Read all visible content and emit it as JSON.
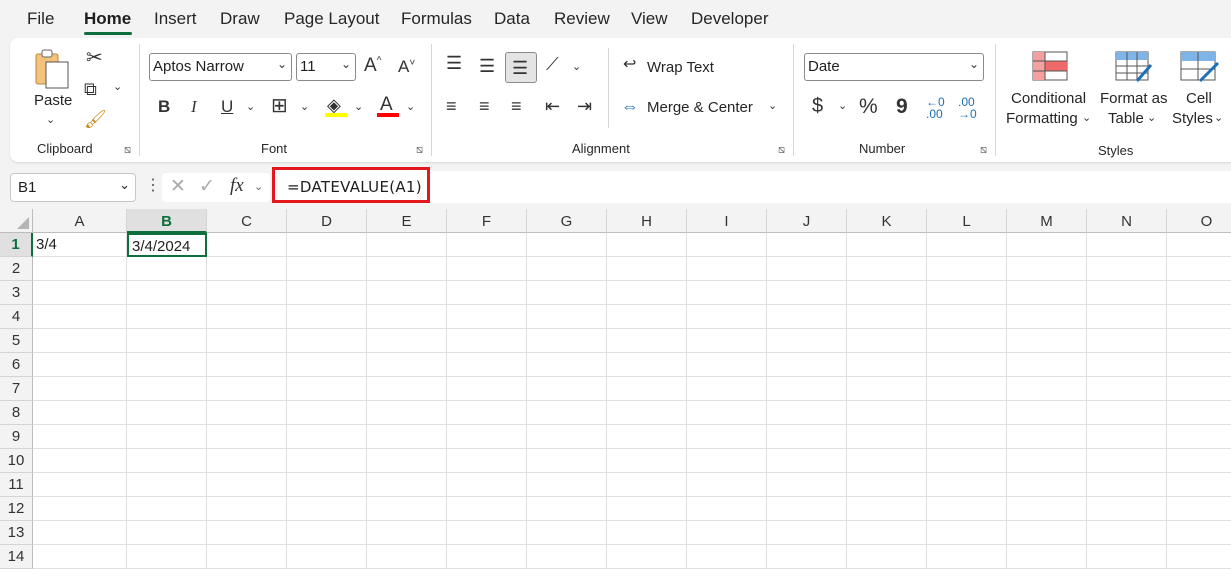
{
  "menu": {
    "tabs": [
      "File",
      "Home",
      "Insert",
      "Draw",
      "Page Layout",
      "Formulas",
      "Data",
      "Review",
      "View",
      "Developer"
    ],
    "active": "Home"
  },
  "ribbon": {
    "clipboard": {
      "paste_label": "Paste",
      "group_label": "Clipboard"
    },
    "font": {
      "name": "Aptos Narrow",
      "size": "11",
      "group_label": "Font",
      "bold": "B",
      "italic": "I",
      "underline": "U",
      "font_color_letter": "A",
      "highlight_color": "#ffff00",
      "font_color": "#ff0000"
    },
    "alignment": {
      "wrap_text": "Wrap Text",
      "merge_center": "Merge & Center",
      "group_label": "Alignment"
    },
    "number": {
      "format": "Date",
      "currency": "$",
      "percent": "%",
      "comma": "9",
      "group_label": "Number"
    },
    "styles": {
      "conditional_1": "Conditional",
      "conditional_2": "Formatting",
      "format_table_1": "Format as",
      "format_table_2": "Table",
      "cell_styles_1": "Cell",
      "cell_styles_2": "Styles",
      "group_label": "Styles"
    }
  },
  "formula_bar": {
    "name_box": "B1",
    "formula": "=DATEVALUE(A1)",
    "fx": "fx"
  },
  "sheet": {
    "columns": [
      "A",
      "B",
      "C",
      "D",
      "E",
      "F",
      "G",
      "H",
      "I",
      "J",
      "K",
      "L",
      "M",
      "N",
      "O"
    ],
    "rows": [
      "1",
      "2",
      "3",
      "4",
      "5",
      "6",
      "7",
      "8",
      "9",
      "10",
      "11",
      "12",
      "13",
      "14"
    ],
    "cells": {
      "A1": "3/4",
      "B1": "3/4/2024"
    },
    "active_cell": "B1",
    "accent": "#0f6f3c",
    "highlight_border": "#e3181d"
  }
}
